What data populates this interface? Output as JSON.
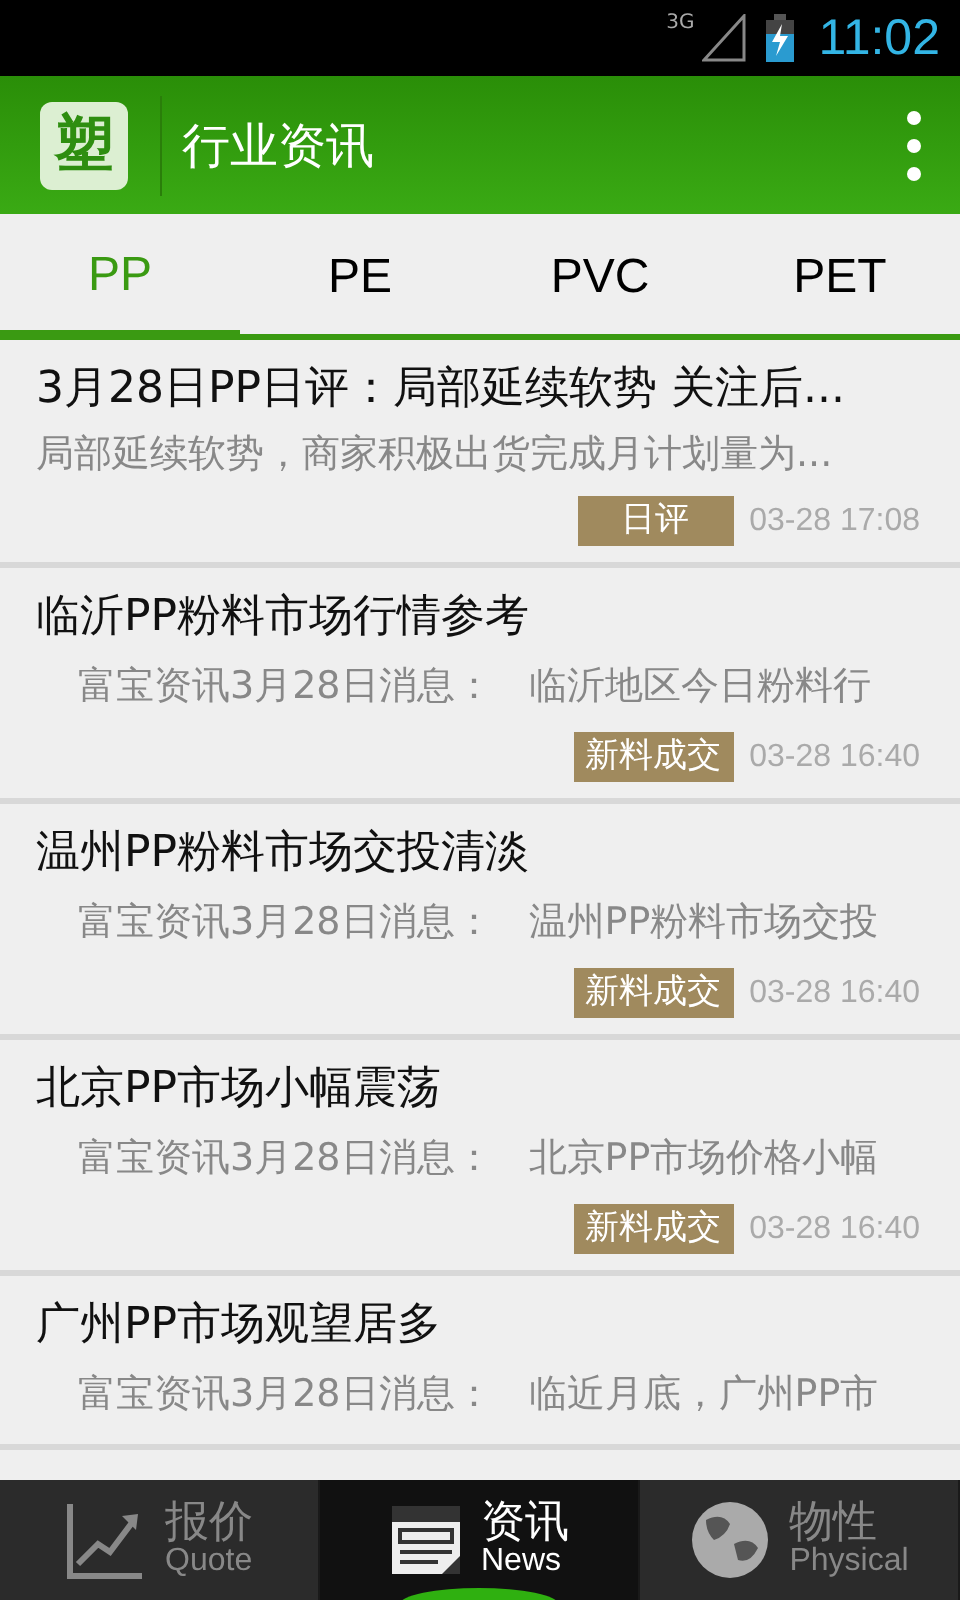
{
  "status_bar": {
    "network": "3G",
    "time": "11:02"
  },
  "action_bar": {
    "logo": "塑",
    "title": "行业资讯"
  },
  "tabs": [
    {
      "label": "PP",
      "selected": true
    },
    {
      "label": "PE",
      "selected": false
    },
    {
      "label": "PVC",
      "selected": false
    },
    {
      "label": "PET",
      "selected": false
    }
  ],
  "news": [
    {
      "kind": "excerpt",
      "title": "3月28日PP日评：局部延续软势 关注后...",
      "summary": "局部延续软势，商家积极出货完成月计划量为...",
      "tag": "日评",
      "time": "03-28 17:08"
    },
    {
      "kind": "quote",
      "title": "临沂PP粉料市场行情参考",
      "source": "富宝资讯3月28日消息：",
      "summary": "临沂地区今日粉料行",
      "tag": "新料成交",
      "time": "03-28 16:40"
    },
    {
      "kind": "quote",
      "title": "温州PP粉料市场交投清淡",
      "source": "富宝资讯3月28日消息：",
      "summary": "温州PP粉料市场交投",
      "tag": "新料成交",
      "time": "03-28 16:40"
    },
    {
      "kind": "quote",
      "title": "北京PP市场小幅震荡",
      "source": "富宝资讯3月28日消息：",
      "summary": "北京PP市场价格小幅",
      "tag": "新料成交",
      "time": "03-28 16:40"
    },
    {
      "kind": "quote",
      "title": "广州PP市场观望居多",
      "source": "富宝资讯3月28日消息：",
      "summary": "临近月底，广州PP市"
    }
  ],
  "bottom_nav": [
    {
      "kind": "chart",
      "label": "报价",
      "sublabel": "Quote",
      "selected": false
    },
    {
      "kind": "news",
      "label": "资讯",
      "sublabel": "News",
      "selected": true
    },
    {
      "kind": "globe",
      "label": "物性",
      "sublabel": "Physical",
      "selected": false
    }
  ]
}
